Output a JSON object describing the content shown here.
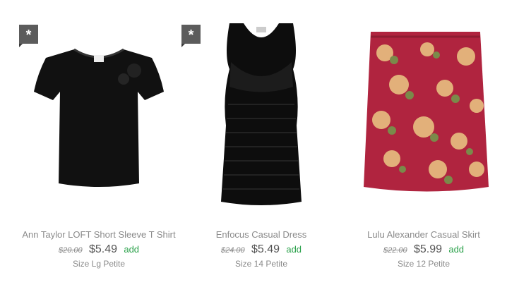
{
  "products": [
    {
      "title": "Ann Taylor LOFT Short Sleeve T Shirt",
      "original_price": "$20.00",
      "price": "$5.49",
      "add_label": "add",
      "size": "Size Lg Petite",
      "badge_icon": "star-icon",
      "badge": "*"
    },
    {
      "title": "Enfocus Casual Dress",
      "original_price": "$24.00",
      "price": "$5.49",
      "add_label": "add",
      "size": "Size 14 Petite",
      "badge_icon": "star-icon",
      "badge": "*"
    },
    {
      "title": "Lulu Alexander Casual Skirt",
      "original_price": "$22.00",
      "price": "$5.99",
      "add_label": "add",
      "size": "Size 12 Petite"
    }
  ],
  "colors": {
    "add": "#2aa14a",
    "badge": "#5c5c5c"
  }
}
